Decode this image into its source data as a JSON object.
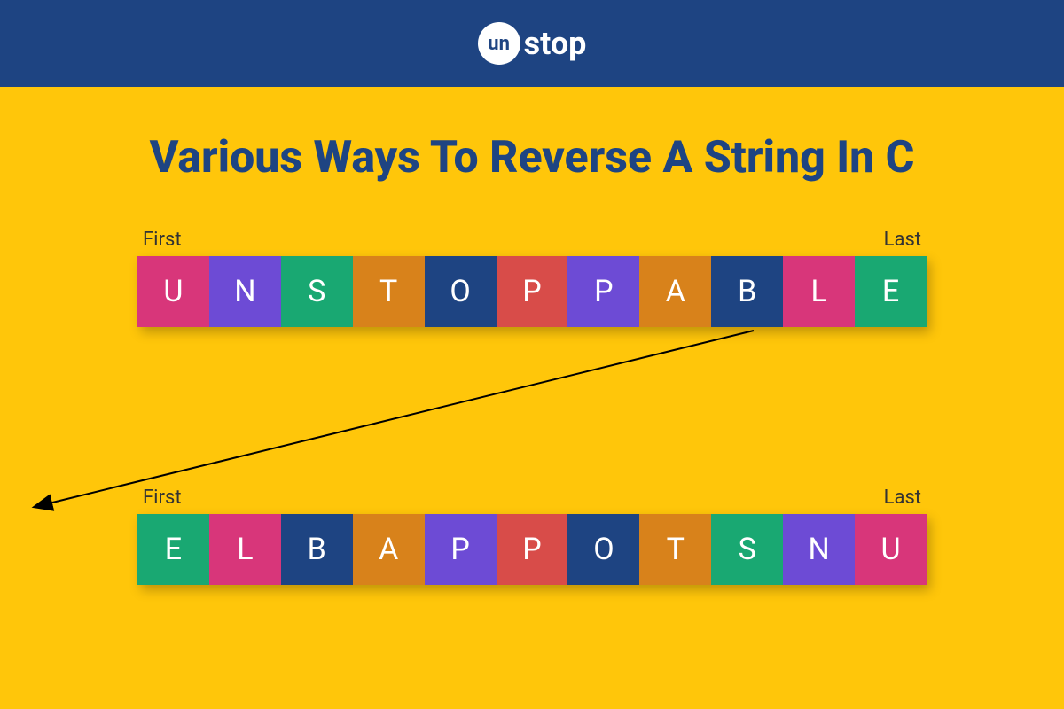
{
  "header": {
    "logo_left": "un",
    "logo_right": "stop"
  },
  "title": "Various Ways To Reverse A String In C",
  "labels": {
    "first": "First",
    "last": "Last"
  },
  "colors": {
    "pink": "#d8367a",
    "purple": "#6d4bd5",
    "green": "#19a872",
    "orange": "#d8821b",
    "navy": "#1e4482",
    "red": "#d84c49"
  },
  "row1": {
    "cells": [
      {
        "letter": "U",
        "color": "pink"
      },
      {
        "letter": "N",
        "color": "purple"
      },
      {
        "letter": "S",
        "color": "green"
      },
      {
        "letter": "T",
        "color": "orange"
      },
      {
        "letter": "O",
        "color": "navy"
      },
      {
        "letter": "P",
        "color": "red"
      },
      {
        "letter": "P",
        "color": "purple"
      },
      {
        "letter": "A",
        "color": "orange"
      },
      {
        "letter": "B",
        "color": "navy"
      },
      {
        "letter": "L",
        "color": "pink"
      },
      {
        "letter": "E",
        "color": "green"
      }
    ]
  },
  "row2": {
    "cells": [
      {
        "letter": "E",
        "color": "green"
      },
      {
        "letter": "L",
        "color": "pink"
      },
      {
        "letter": "B",
        "color": "navy"
      },
      {
        "letter": "A",
        "color": "orange"
      },
      {
        "letter": "P",
        "color": "purple"
      },
      {
        "letter": "P",
        "color": "red"
      },
      {
        "letter": "O",
        "color": "navy"
      },
      {
        "letter": "T",
        "color": "orange"
      },
      {
        "letter": "S",
        "color": "green"
      },
      {
        "letter": "N",
        "color": "purple"
      },
      {
        "letter": "U",
        "color": "pink"
      }
    ]
  }
}
